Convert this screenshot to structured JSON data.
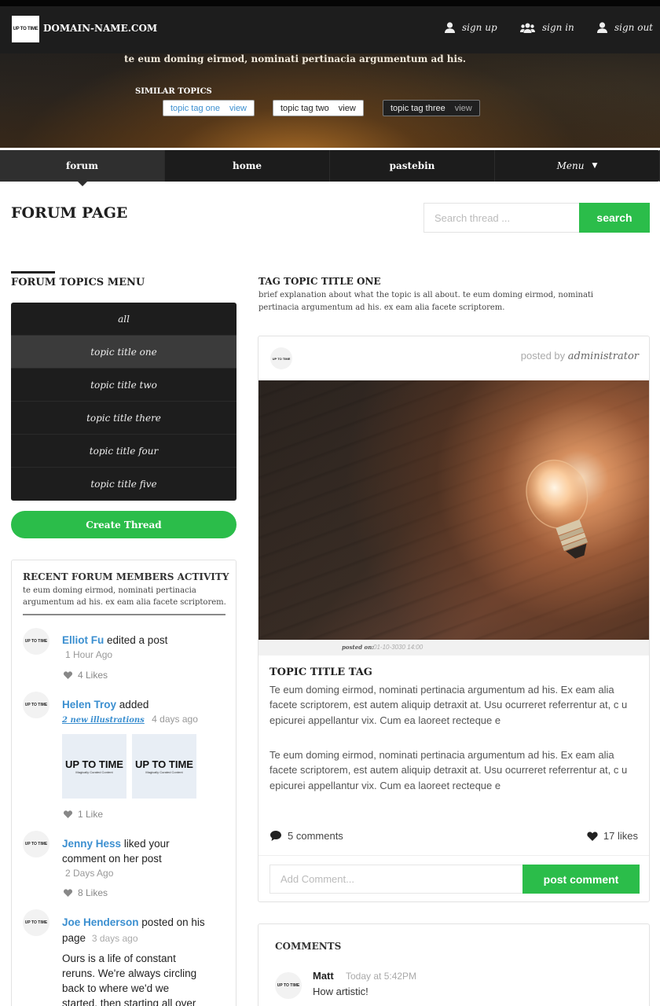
{
  "header": {
    "logo_text": "UP TO TIME",
    "domain": "DOMAIN-NAME.COM",
    "links": {
      "signup": "sign up",
      "signin": "sign in",
      "signout": "sign out"
    },
    "hero_text": "te eum doming eirmod, nominati pertinacia argumentum ad his.",
    "similar_label": "SIMILAR TOPICS",
    "tags": [
      {
        "label": "topic tag one",
        "view": "view"
      },
      {
        "label": "topic tag two",
        "view": "view"
      },
      {
        "label": "topic tag three",
        "view": "view"
      }
    ]
  },
  "nav": {
    "items": [
      "forum",
      "home",
      "pastebin",
      "Menu"
    ],
    "active": "forum"
  },
  "page": {
    "title": "FORUM PAGE",
    "search_placeholder": "Search thread ...",
    "search_button": "search"
  },
  "topics": {
    "title": "FORUM TOPICS MENU",
    "items": [
      "all",
      "topic title one",
      "topic title two",
      "topic title there",
      "topic title four",
      "topic title five"
    ],
    "active": "topic title one",
    "create_button": "Create Thread"
  },
  "activity": {
    "title": "RECENT FORUM MEMBERS ACTIVITY",
    "desc": "te eum doming eirmod, nominati pertinacia argumentum ad his. ex eam alia facete scriptorem.",
    "items": [
      {
        "name": "Elliot Fu",
        "action": "edited a post",
        "time": "1 Hour Ago",
        "likes": "4 Likes"
      },
      {
        "name": "Helen Troy",
        "action": "added",
        "link": "2 new illustrations",
        "time": "4 days ago",
        "likes": "1 Like",
        "thumb_text": "UP TO TIME",
        "thumb_sub": "Magically Curated Content"
      },
      {
        "name": "Jenny Hess",
        "action": "liked your",
        "action2": "comment on her post",
        "time": "2 Days Ago",
        "likes": "8 Likes"
      },
      {
        "name": "Joe Henderson",
        "action": "posted on his",
        "action2": "page",
        "time": "3 days ago",
        "text": [
          "Ours is a life of constant",
          "reruns. We're always circling",
          "back to where we'd we",
          "started, then starting all over"
        ]
      }
    ]
  },
  "topic": {
    "title": "TAG TOPIC TITLE ONE",
    "desc": "brief explanation about what the topic is all about. te eum doming eirmod, nominati pertinacia argumentum ad his. ex eam alia facete scriptorem."
  },
  "post": {
    "posted_by_label": "posted by",
    "author": "administrator",
    "posted_on_label": "posted on:",
    "posted_on": "01-10-3030 14:00",
    "title": "TOPIC TITLE TAG",
    "para1": "Te eum doming eirmod, nominati pertinacia argumentum ad his. Ex eam alia facete scriptorem, est autem aliquip detraxit at. Usu ocurreret referrentur at, c u epicurei appellantur vix. Cum ea laoreet recteque e",
    "para2": "Te eum doming eirmod, nominati pertinacia argumentum ad his. Ex eam alia facete scriptorem, est autem aliquip detraxit at. Usu ocurreret referrentur at, c u epicurei appellantur vix. Cum ea laoreet recteque e",
    "comments": "5 comments",
    "likes": "17 likes",
    "comment_placeholder": "Add Comment...",
    "comment_button": "post comment"
  },
  "comments": {
    "title": "COMMENTS",
    "items": [
      {
        "author": "Matt",
        "time": "Today at 5:42PM",
        "text": "How artistic!"
      }
    ]
  }
}
